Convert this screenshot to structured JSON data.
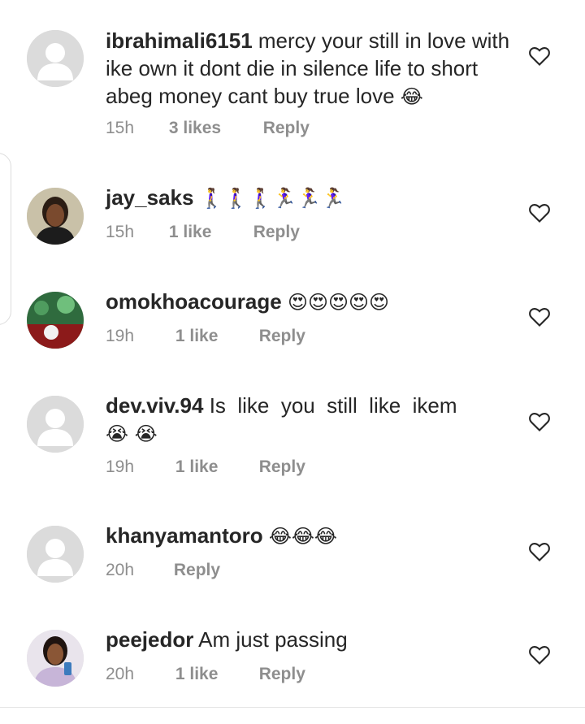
{
  "comments": [
    {
      "username": "ibrahimali6151",
      "text": "mercy your still in love with ike own it dont die in silence life to short abeg money cant buy true love",
      "emoji": "😂",
      "time": "15h",
      "likes": "3 likes",
      "reply": "Reply",
      "avatar": "default"
    },
    {
      "username": "jay_saks",
      "text": "",
      "emoji": "🚶‍♀️🚶‍♀️🚶‍♀️🏃‍♀️🏃‍♀️🏃‍♀️",
      "time": "15h",
      "likes": "1 like",
      "reply": "Reply",
      "avatar": "photo-woman"
    },
    {
      "username": "omokhoacourage",
      "text": "",
      "emoji": "😍😍😍😍😍",
      "time": "19h",
      "likes": "1 like",
      "reply": "Reply",
      "avatar": "photo-flag"
    },
    {
      "username": "dev.viv.94",
      "text": "Is  like  you  still  like  ikem",
      "emoji": "😭 😭",
      "time": "19h",
      "likes": "1 like",
      "reply": "Reply",
      "avatar": "default"
    },
    {
      "username": "khanyamantoro",
      "text": "",
      "emoji": "😂😂😂",
      "time": "20h",
      "likes": "",
      "reply": "Reply",
      "avatar": "default"
    },
    {
      "username": "peejedor",
      "text": "Am just passing",
      "emoji": "",
      "time": "20h",
      "likes": "1 like",
      "reply": "Reply",
      "avatar": "photo-woman2"
    }
  ],
  "icons": {
    "like": "heart-outline-icon",
    "avatar_default": "person-silhouette-icon"
  },
  "colors": {
    "text": "#262626",
    "meta": "#8e8e8e",
    "avatar_bg": "#d9d9d9"
  }
}
